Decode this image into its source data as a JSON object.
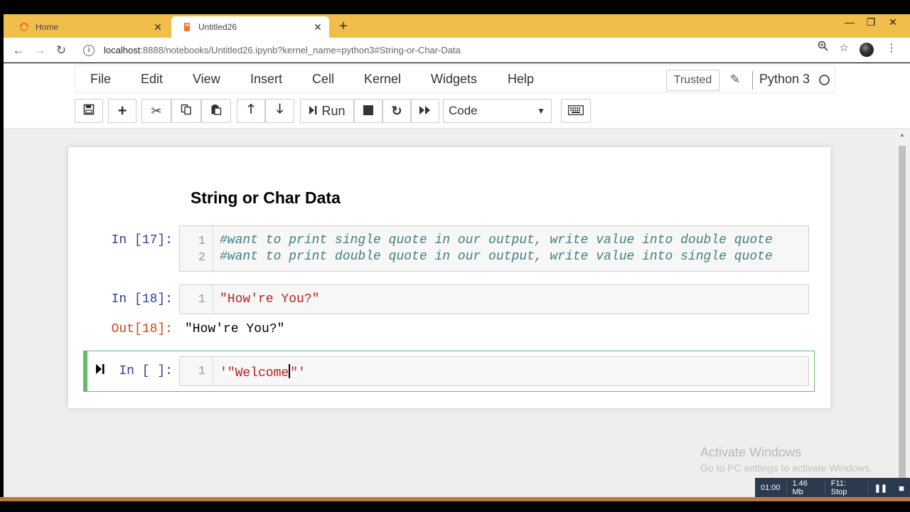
{
  "browser": {
    "tabs": [
      {
        "label": "Home",
        "icon": "jupyter-icon",
        "active": false
      },
      {
        "label": "Untitled26",
        "icon": "notebook-icon",
        "active": true
      }
    ],
    "new_tab": "+",
    "window_controls": {
      "minimize": "—",
      "restore": "❐",
      "close": "✕"
    },
    "url_host": "localhost",
    "url_rest": ":8888/notebooks/Untitled26.ipynb?kernel_name=python3#String-or-Char-Data"
  },
  "menubar": {
    "items": [
      "File",
      "Edit",
      "View",
      "Insert",
      "Cell",
      "Kernel",
      "Widgets",
      "Help"
    ],
    "trusted": "Trusted",
    "kernel": "Python 3"
  },
  "toolbar": {
    "run_label": "Run",
    "cell_type": "Code"
  },
  "notebook": {
    "heading": "String or Char Data",
    "cells": [
      {
        "prompt": "In [17]:",
        "lines": [
          {
            "n": "1",
            "code": "#want to print single quote in our output, write value into double quote"
          },
          {
            "n": "2",
            "code": "#want to print double quote in our output, write value into single quote"
          }
        ]
      },
      {
        "prompt": "In [18]:",
        "lines": [
          {
            "n": "1",
            "code": "\"How're You?\""
          }
        ],
        "output_prompt": "Out[18]:",
        "output": "\"How're You?\""
      },
      {
        "prompt": "In [ ]:",
        "lines": [
          {
            "n": "1",
            "code_before": "'\"Welcome",
            "code_after": "\"'"
          }
        ]
      }
    ]
  },
  "watermark": {
    "line1": "Activate Windows",
    "line2": "Go to PC settings to activate Windows."
  },
  "recorder": {
    "time": "01:00",
    "size": "1.46 Mb",
    "stop": "F11: Stop"
  },
  "colors": {
    "chrome_tab_strip": "#f1bd4b",
    "selected_cell_border": "#66bb6a",
    "input_prompt": "#303f9f",
    "output_prompt": "#d84315",
    "comment": "#408080",
    "string": "#ba2121"
  }
}
